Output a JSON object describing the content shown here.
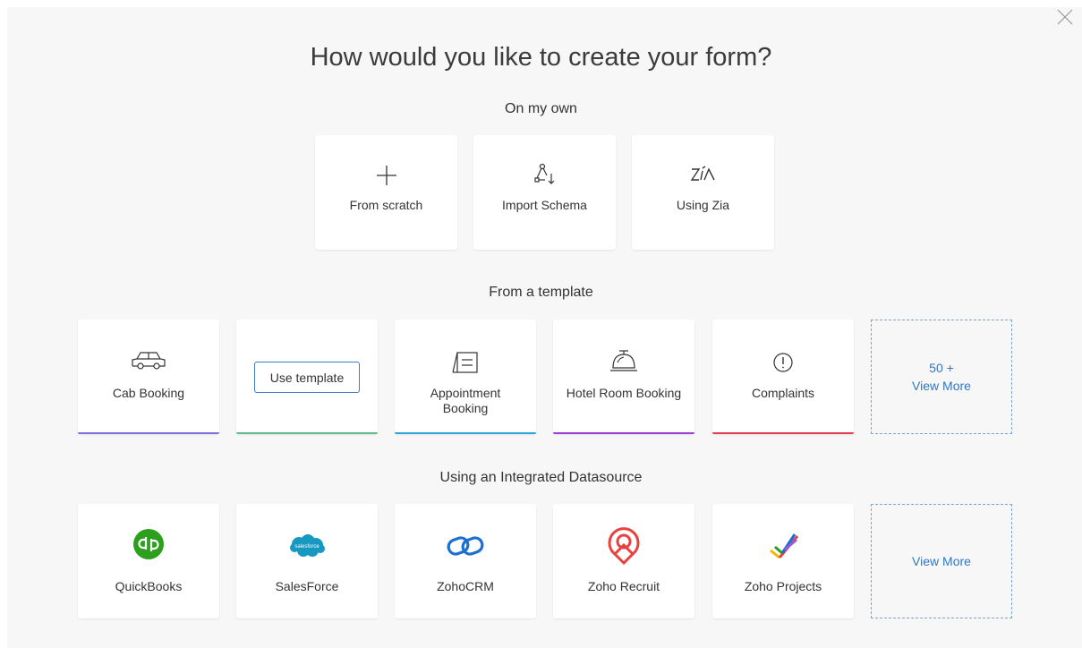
{
  "title": "How would you like to create your form?",
  "sections": {
    "own": "On my own",
    "template": "From a template",
    "datasource": "Using an Integrated Datasource"
  },
  "own_cards": [
    {
      "label": "From scratch",
      "icon": "plus-icon"
    },
    {
      "label": "Import Schema",
      "icon": "import-schema-icon"
    },
    {
      "label": "Using Zia",
      "icon": "zia-icon"
    }
  ],
  "template_cards": [
    {
      "label": "Cab Booking",
      "icon": "car-icon",
      "bar_color": "#7b6fe0"
    },
    {
      "button": "Use template",
      "icon": "",
      "bar_color": "#5dbb8a"
    },
    {
      "label": "Appointment Booking",
      "label_line1": "Appointment",
      "label_line2": "Booking",
      "icon": "appointment-board-icon",
      "bar_color": "#2aa6d9"
    },
    {
      "label": "Hotel Room Booking",
      "icon": "hotel-bell-icon",
      "bar_color": "#9c3cd3"
    },
    {
      "label": "Complaints",
      "icon": "exclamation-circle-icon",
      "bar_color": "#e53b52"
    }
  ],
  "template_more": {
    "count": "50 +",
    "label": "View More"
  },
  "datasource_cards": [
    {
      "label": "QuickBooks",
      "icon": "quickbooks-logo-icon",
      "color": "#2ca01c"
    },
    {
      "label": "SalesForce",
      "icon": "salesforce-logo-icon",
      "color": "#1798c1",
      "logo_text": "salesforce"
    },
    {
      "label": "ZohoCRM",
      "icon": "zohocrm-logo-icon",
      "color": "#1a6fd0"
    },
    {
      "label": "Zoho Recruit",
      "icon": "zoho-recruit-logo-icon",
      "color": "#e8423f"
    },
    {
      "label": "Zoho Projects",
      "icon": "zoho-projects-logo-icon",
      "color": "#9a5ad8"
    }
  ],
  "datasource_more": {
    "label": "View More"
  },
  "colors": {
    "accent": "#2f78c5",
    "dashed_border": "#7aa3d6"
  }
}
